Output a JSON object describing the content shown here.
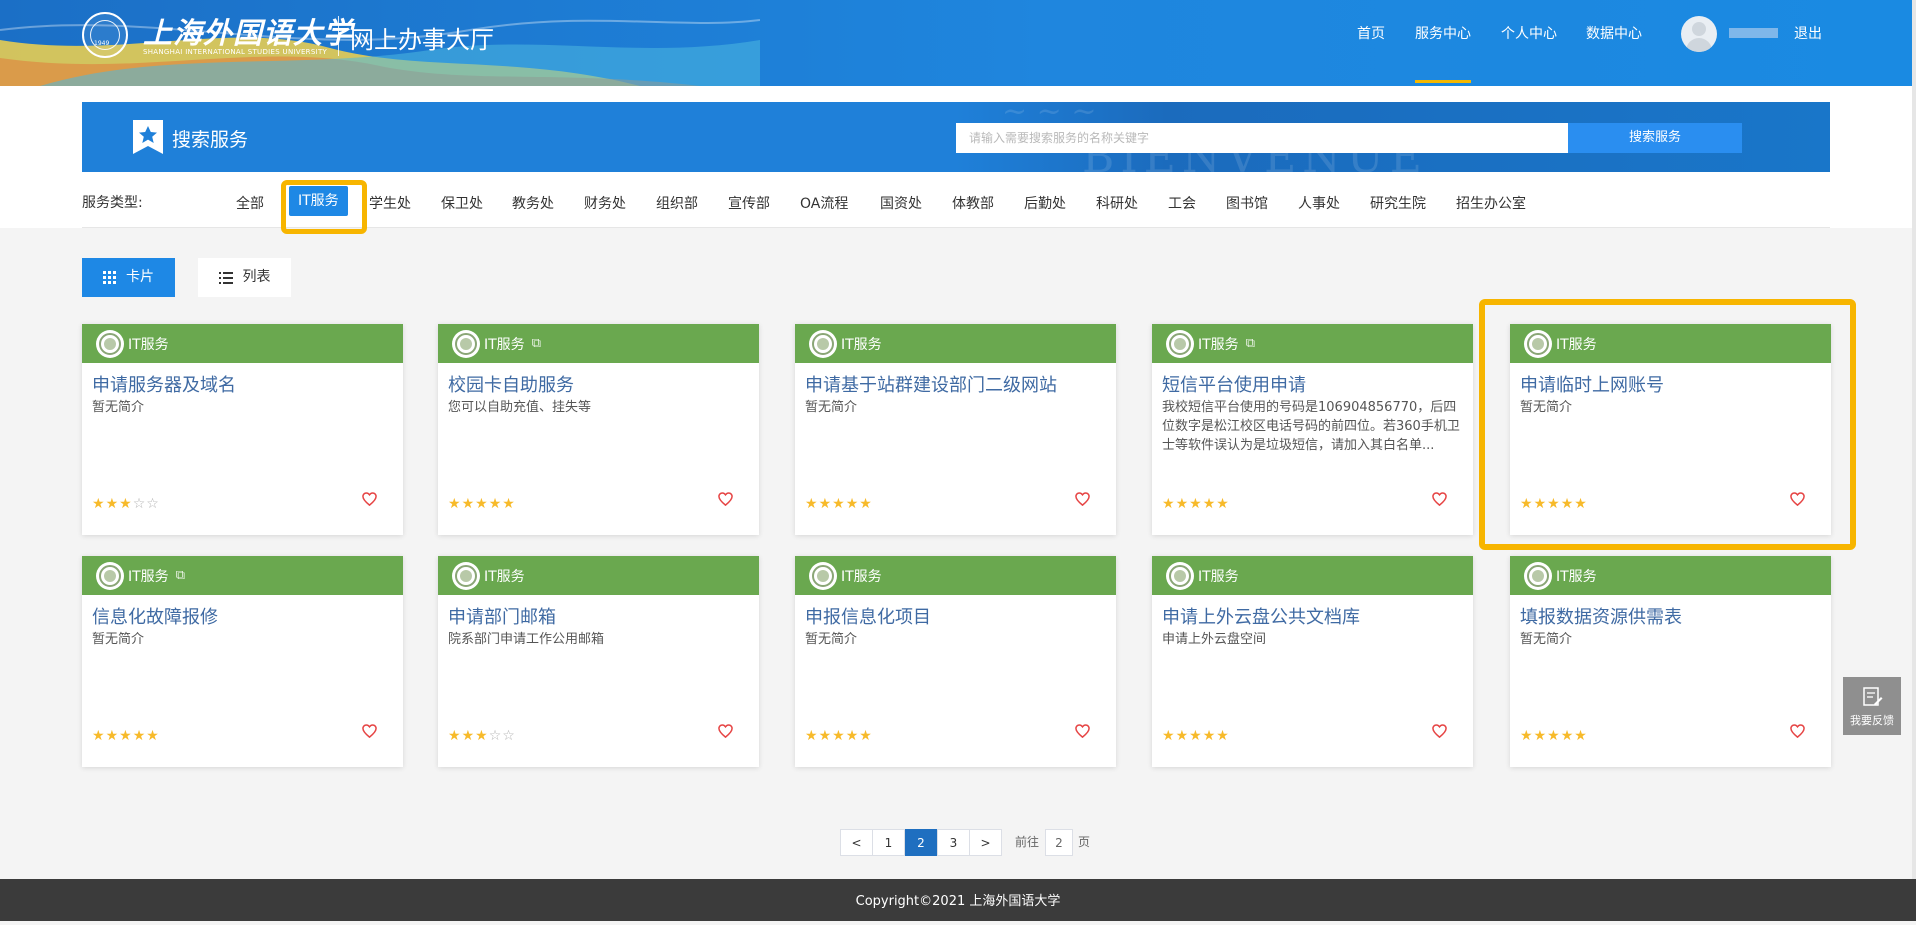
{
  "header": {
    "school_name_cn": "上海外国语大学",
    "school_name_en": "SHANGHAI INTERNATIONAL STUDIES UNIVERSITY",
    "seal_year": "1949",
    "portal_title": "网上办事大厅",
    "nav": [
      "首页",
      "服务中心",
      "个人中心",
      "数据中心"
    ],
    "active_nav": "服务中心",
    "logout": "退出"
  },
  "search": {
    "title": "搜索服务",
    "placeholder": "请输入需要搜索服务的名称关键字",
    "button": "搜索服务",
    "banner_text": "BIENVENUE"
  },
  "types": {
    "label": "服务类型:",
    "items": [
      "全部",
      "IT服务",
      "学生处",
      "保卫处",
      "教务处",
      "财务处",
      "组织部",
      "宣传部",
      "OA流程",
      "国资处",
      "体教部",
      "后勤处",
      "科研处",
      "工会",
      "图书馆",
      "人事处",
      "研究生院",
      "招生办公室"
    ],
    "active": "IT服务"
  },
  "view": {
    "card": "卡片",
    "list": "列表"
  },
  "cards": [
    {
      "category": "IT服务",
      "external": false,
      "title": "申请服务器及域名",
      "desc": "暂无简介",
      "rating": 3
    },
    {
      "category": "IT服务",
      "external": true,
      "title": "校园卡自助服务",
      "desc": "您可以自助充值、挂失等",
      "rating": 5
    },
    {
      "category": "IT服务",
      "external": false,
      "title": "申请基于站群建设部门二级网站",
      "desc": "暂无简介",
      "rating": 5
    },
    {
      "category": "IT服务",
      "external": true,
      "title": "短信平台使用申请",
      "desc": "我校短信平台使用的号码是106904856770，后四位数字是松江校区电话号码的前四位。若360手机卫士等软件误认为是垃圾短信，请加入其白名单...",
      "rating": 5
    },
    {
      "category": "IT服务",
      "external": false,
      "title": "申请临时上网账号",
      "desc": "暂无简介",
      "rating": 5
    },
    {
      "category": "IT服务",
      "external": true,
      "title": "信息化故障报修",
      "desc": "暂无简介",
      "rating": 5
    },
    {
      "category": "IT服务",
      "external": false,
      "title": "申请部门邮箱",
      "desc": "院系部门申请工作公用邮箱",
      "rating": 3
    },
    {
      "category": "IT服务",
      "external": false,
      "title": "申报信息化项目",
      "desc": "暂无简介",
      "rating": 5
    },
    {
      "category": "IT服务",
      "external": false,
      "title": "申请上外云盘公共文档库",
      "desc": "申请上外云盘空间",
      "rating": 5
    },
    {
      "category": "IT服务",
      "external": false,
      "title": "填报数据资源供需表",
      "desc": "暂无简介",
      "rating": 5
    }
  ],
  "pagination": {
    "prev": "<",
    "next": ">",
    "pages": [
      "1",
      "2",
      "3"
    ],
    "current": "2",
    "goto_prefix": "前往",
    "goto_value": "2",
    "goto_suffix": "页"
  },
  "feedback": "我要反馈",
  "footer": "Copyright©2021 上海外国语大学",
  "colors": {
    "header_blue": "#1f86de",
    "accent_blue": "#1e88e5",
    "card_green": "#6aa84f",
    "title_blue": "#3f6aa3",
    "star_gold": "#f7ba2a",
    "highlight_yellow": "#f7b500",
    "heart_red": "#e64545"
  }
}
